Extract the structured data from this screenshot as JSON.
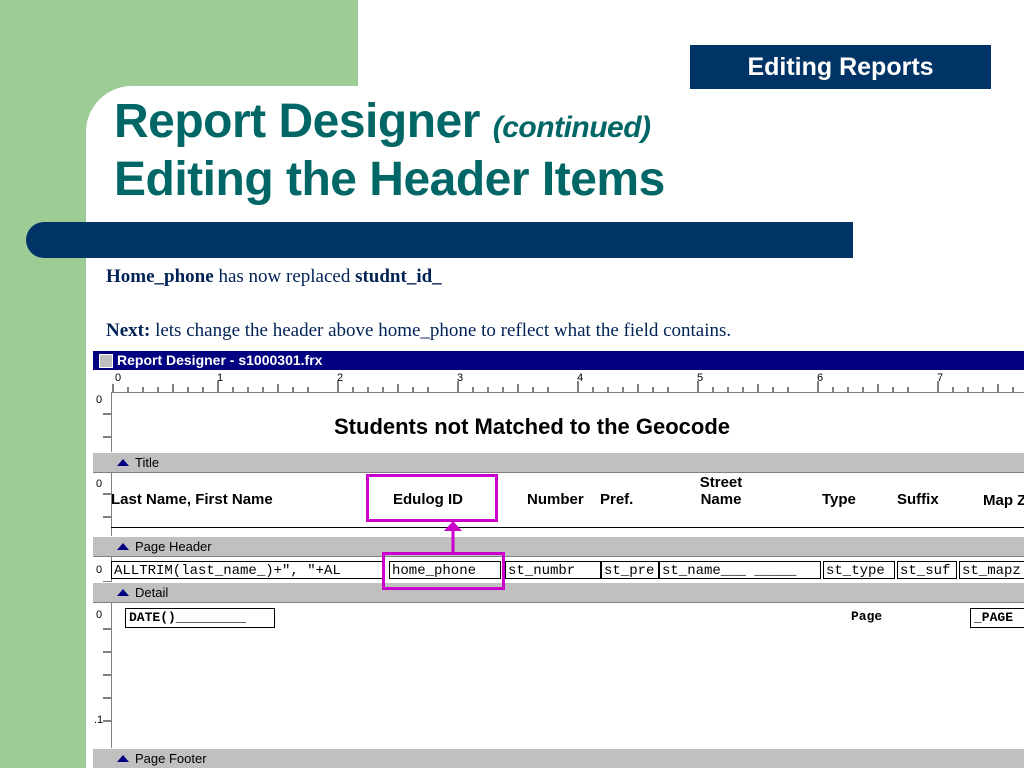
{
  "badge": "Editing Reports",
  "title": {
    "main": "Report Designer",
    "sub": "(continued)",
    "line2": "Editing the Header Items"
  },
  "body": {
    "l1_bold": "Home_phone",
    "l1_mid": " has now replaced ",
    "l1_bold2": "studnt_id_",
    "l2_bold": "Next:",
    "l2_rest": " lets change the header above home_phone to reflect what the field contains."
  },
  "window": {
    "title": "Report Designer - s1000301.frx"
  },
  "ruler": {
    "h": [
      "0",
      "1",
      "2",
      "3",
      "4",
      "5",
      "6",
      "7"
    ],
    "v": [
      "0",
      "0",
      "0",
      "0",
      ".1"
    ]
  },
  "report": {
    "title": "Students not Matched to the Geocode",
    "bands": [
      "Title",
      "Page Header",
      "Detail",
      "Page Footer"
    ],
    "headers": {
      "name": "Last Name, First Name",
      "edulog": "Edulog ID",
      "number": "Number",
      "pref": "Pref.",
      "street1": "Street",
      "street2": "Name",
      "type": "Type",
      "suffix": "Suffix",
      "map": "Map Z"
    },
    "fields": [
      "ALLTRIM(last_name_)+\", \"+AL",
      "home_phone",
      "st_numbr",
      "st_pre",
      "st_name___ _____",
      "st_type",
      "st_suf",
      "st_mapz"
    ],
    "detail": {
      "date": "DATE()_________",
      "page_label": "Page",
      "page_field": "_PAGE"
    }
  },
  "colors": {
    "accent": "#003366",
    "title": "#006666",
    "highlight": "#cc00cc",
    "background": "#9dcc95"
  }
}
